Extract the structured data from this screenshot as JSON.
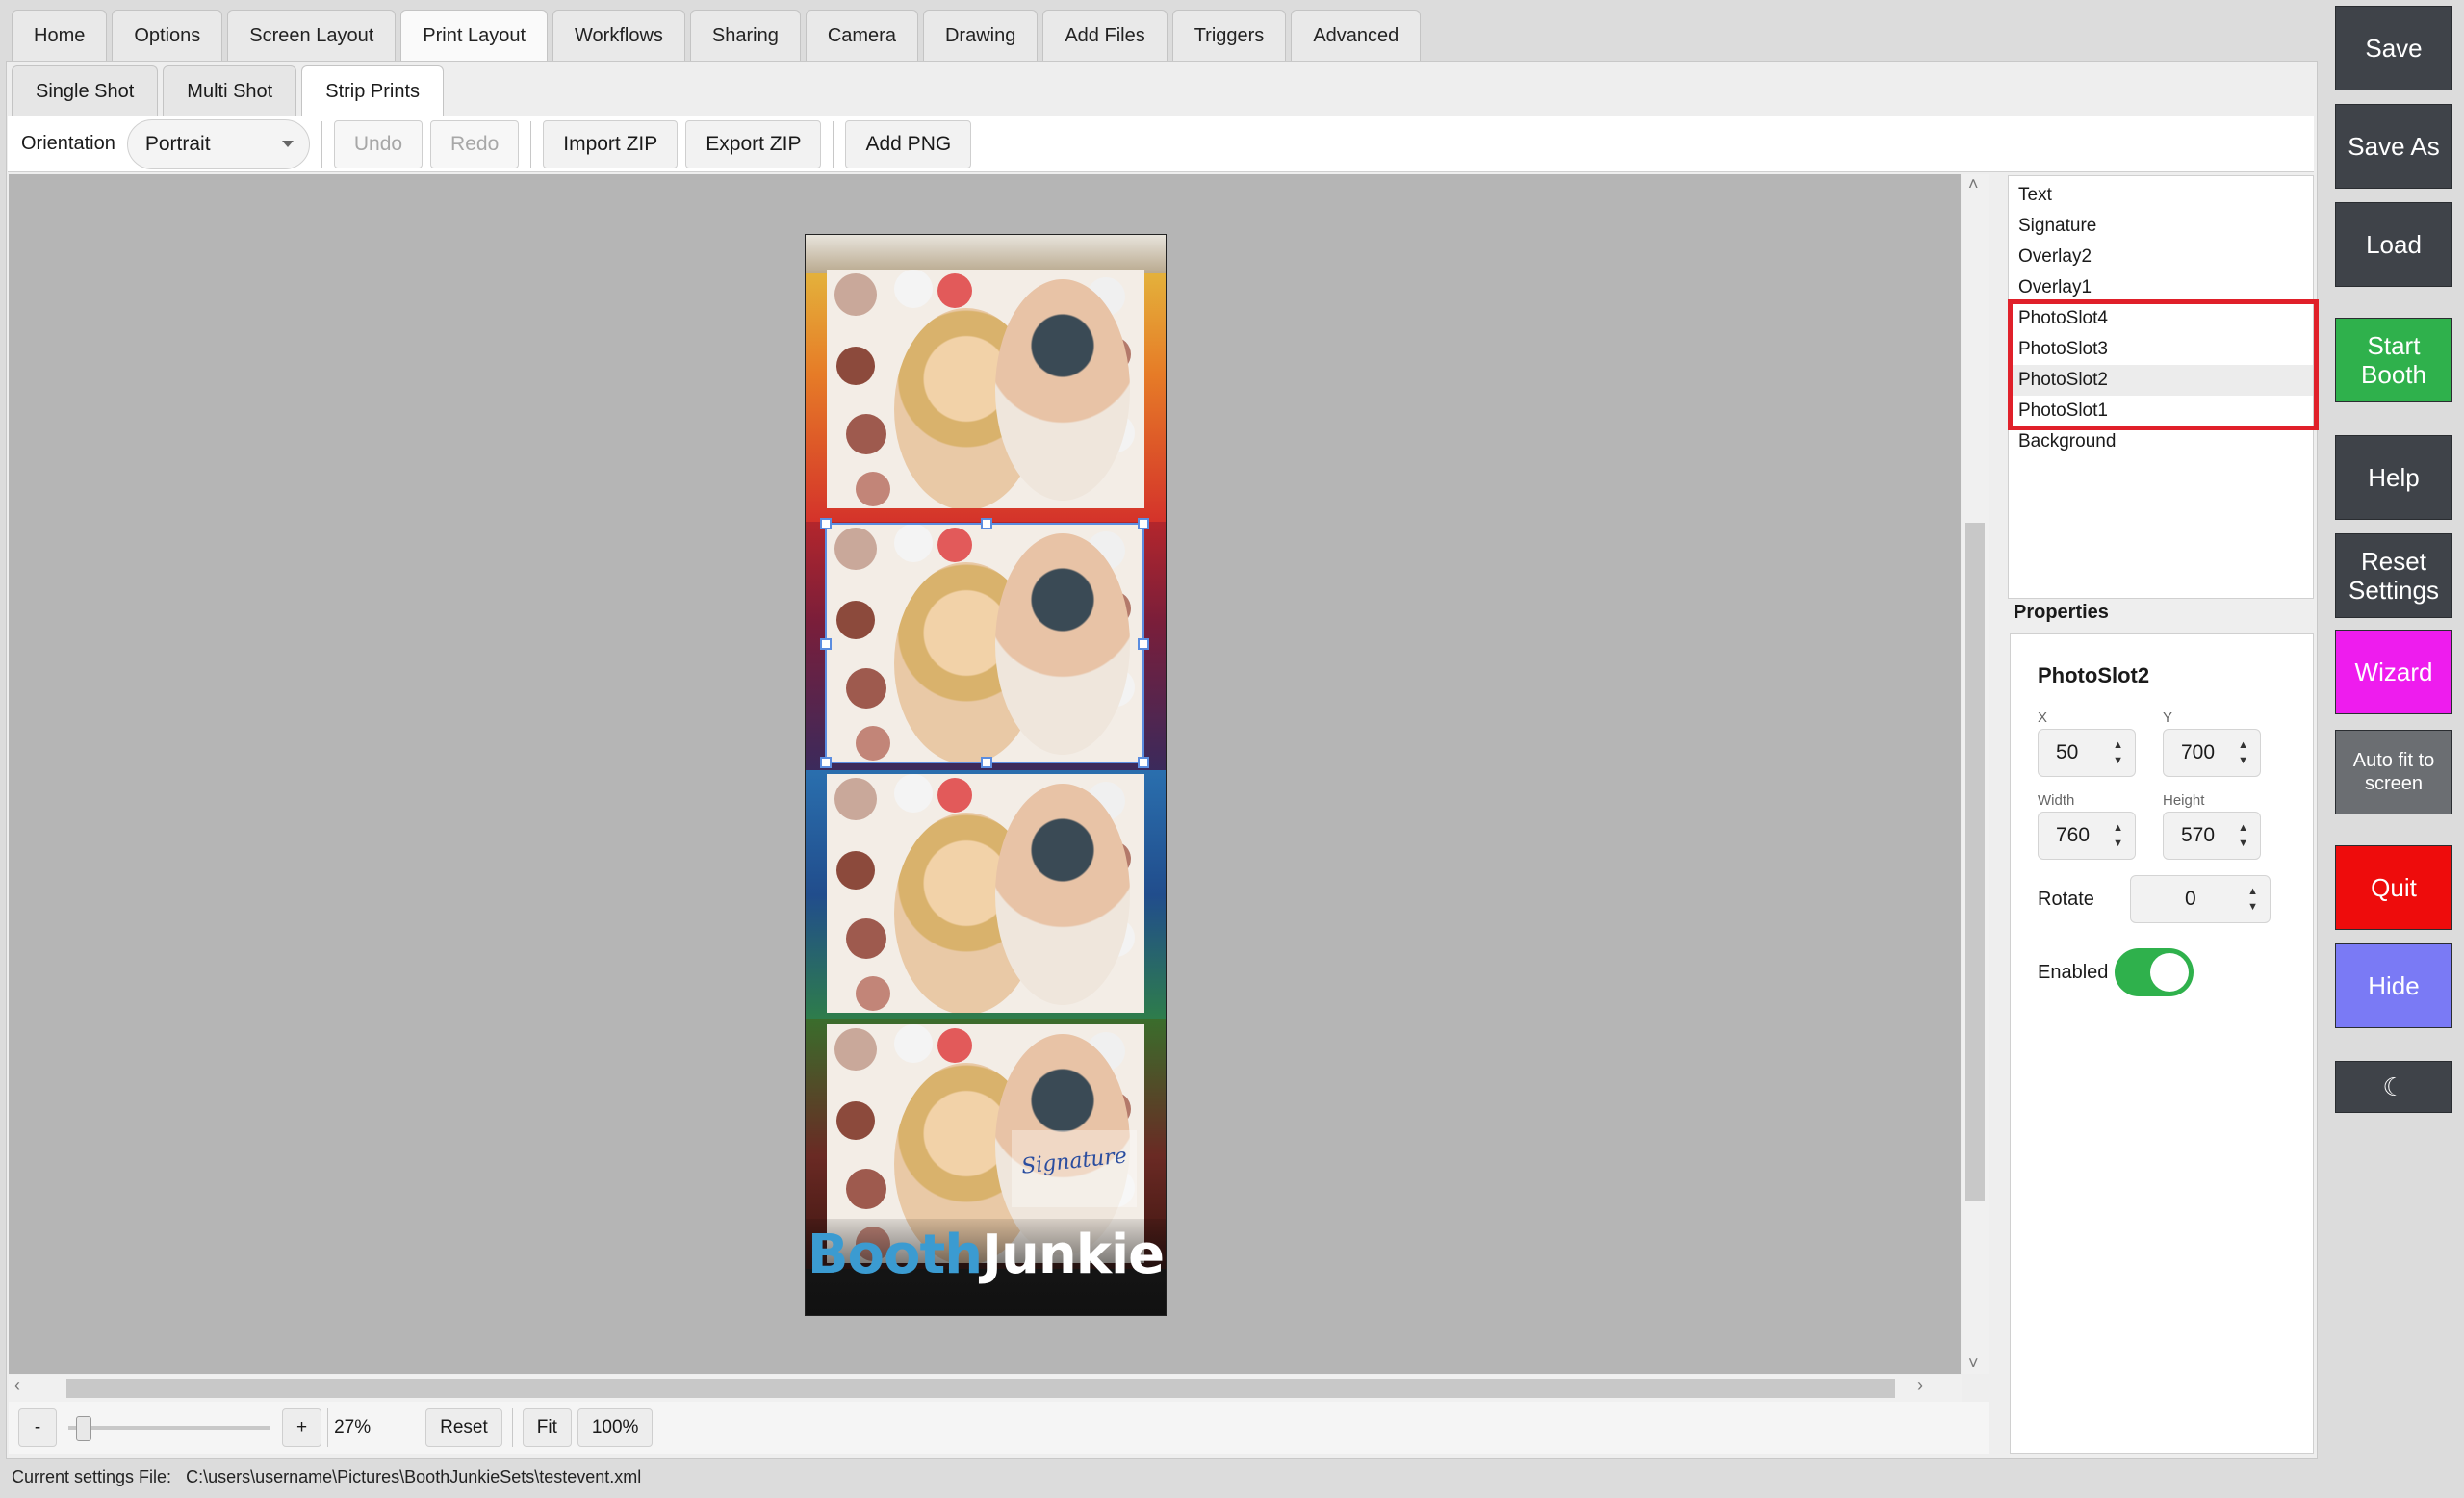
{
  "main_tabs": [
    "Home",
    "Options",
    "Screen Layout",
    "Print Layout",
    "Workflows",
    "Sharing",
    "Camera",
    "Drawing",
    "Add Files",
    "Triggers",
    "Advanced"
  ],
  "sub_tabs": [
    "Single Shot",
    "Multi Shot",
    "Strip Prints"
  ],
  "toolbar": {
    "orientation_label": "Orientation",
    "orientation_value": "Portrait",
    "undo": "Undo",
    "redo": "Redo",
    "import_zip": "Import ZIP",
    "export_zip": "Export ZIP",
    "add_png": "Add PNG"
  },
  "strip": {
    "logo_part1": "Booth",
    "logo_part2": "Junkie",
    "signature": "Signature"
  },
  "layers": [
    "Text",
    "Signature",
    "Overlay2",
    "Overlay1",
    "PhotoSlot4",
    "PhotoSlot3",
    "PhotoSlot2",
    "PhotoSlot1",
    "Background"
  ],
  "selected_layer": "PhotoSlot2",
  "properties": {
    "title": "Properties",
    "name": "PhotoSlot2",
    "x_label": "X",
    "x": "50",
    "y_label": "Y",
    "y": "700",
    "width_label": "Width",
    "width": "760",
    "height_label": "Height",
    "height": "570",
    "rotate_label": "Rotate",
    "rotate": "0",
    "enabled_label": "Enabled",
    "enabled": true
  },
  "zoom": {
    "minus": "-",
    "plus": "+",
    "value": "27%",
    "reset": "Reset",
    "fit": "Fit",
    "hundred": "100%"
  },
  "status": {
    "label": "Current settings File:",
    "path": "C:\\users\\username\\Pictures\\BoothJunkieSets\\testevent.xml"
  },
  "side_buttons": [
    {
      "label": "Save",
      "color": "#3f4349"
    },
    {
      "label": "Save As",
      "color": "#3f4349"
    },
    {
      "label": "Load",
      "color": "#3f4349"
    },
    {
      "label": "Start\nBooth",
      "color": "#2fb14c"
    },
    {
      "label": "Help",
      "color": "#3f4349"
    },
    {
      "label": "Reset\nSettings",
      "color": "#3f4349"
    },
    {
      "label": "Wizard",
      "color": "#ee1cee"
    },
    {
      "label": "Auto fit to\nscreen",
      "color": "#6b6e72"
    },
    {
      "label": "Quit",
      "color": "#ee0c0c"
    },
    {
      "label": "Hide",
      "color": "#7a7af5"
    },
    {
      "label": "☾",
      "color": "#3f4349"
    }
  ]
}
